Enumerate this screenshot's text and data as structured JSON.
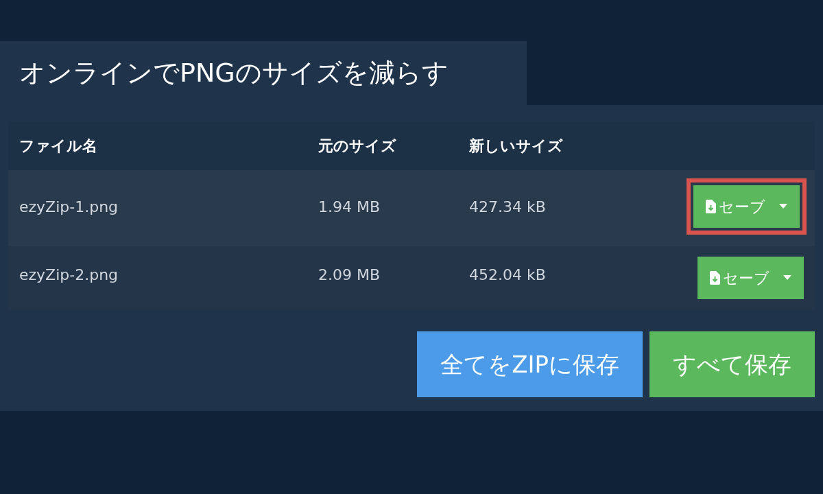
{
  "title": "オンラインでPNGのサイズを減らす",
  "table": {
    "columns": [
      "ファイル名",
      "元のサイズ",
      "新しいサイズ"
    ],
    "rows": [
      {
        "name": "ezyZip-1.png",
        "original_size": "1.94 MB",
        "new_size": "427.34 kB",
        "button": "セーブ",
        "highlighted": true
      },
      {
        "name": "ezyZip-2.png",
        "original_size": "2.09 MB",
        "new_size": "452.04 kB",
        "button": "セーブ",
        "highlighted": false
      }
    ]
  },
  "actions": [
    {
      "label": "全てをZIPに保存",
      "kind": "primary"
    },
    {
      "label": "すべて保存",
      "kind": "success"
    }
  ]
}
